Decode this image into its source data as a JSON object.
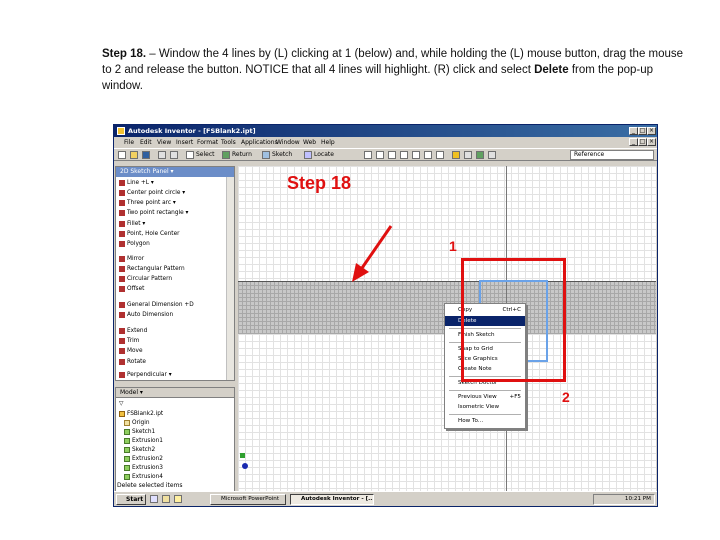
{
  "instruction": {
    "step_label": "Step 18.",
    "text_before_bold": " – Window the 4 lines by (L) clicking at 1 (below) and, while holding the (L) mouse button, drag the mouse to 2 and release the button. NOTICE that all 4 lines will highlight. (R) click and select ",
    "bold_word": "Delete",
    "text_after_bold": " from the pop-up window."
  },
  "window": {
    "title": "Autodesk Inventor - [FSBlank2.ipt]",
    "controls": [
      "_",
      "□",
      "×"
    ]
  },
  "menubar": [
    "File",
    "Edit",
    "View",
    "Insert",
    "Format",
    "Tools",
    "Applications",
    "Window",
    "Web",
    "Help"
  ],
  "toolbar2": {
    "select": "Select",
    "return": "Return",
    "sketch": "Sketch",
    "locate": "Locate",
    "reference": "Reference"
  },
  "panel": {
    "title": "2D Sketch Panel ▾",
    "items": [
      "Line  +L ▾",
      "Center point circle ▾",
      "Three point arc ▾",
      "Two point rectangle ▾",
      "Fillet ▾",
      "Point, Hole Center",
      "Polygon",
      "Mirror",
      "Rectangular Pattern",
      "Circular Pattern",
      "Offset",
      "General Dimension  +D",
      "Auto Dimension",
      "Extend",
      "Trim",
      "Move",
      "Rotate",
      "Perpendicular ▾"
    ]
  },
  "browser": {
    "title": "Model ▾",
    "tree": [
      "FSBlank2.ipt",
      "Origin",
      "Sketch1",
      "Extrusion1",
      "Sketch2",
      "Extrusion2",
      "Extrusion3",
      "Extrusion4"
    ]
  },
  "context_menu": {
    "items": [
      {
        "label": "Copy",
        "shortcut": "Ctrl+C"
      },
      {
        "label": "Delete",
        "shortcut": ""
      },
      {
        "label": "Finish Sketch",
        "shortcut": ""
      },
      {
        "label": "Snap to Grid",
        "shortcut": ""
      },
      {
        "label": "Slice Graphics",
        "shortcut": ""
      },
      {
        "label": "Create Note",
        "shortcut": ""
      },
      {
        "label": "Sketch Doctor",
        "shortcut": ""
      },
      {
        "label": "Previous View",
        "shortcut": "+F5"
      },
      {
        "label": "Isometric View",
        "shortcut": ""
      },
      {
        "label": "How To...",
        "shortcut": ""
      }
    ]
  },
  "status": "Delete selected items",
  "taskbar": {
    "start": "Start",
    "buttons": [
      "Microsoft PowerPoint",
      "Autodesk Inventor - [..."
    ],
    "clock": "10:21 PM"
  },
  "annotations": {
    "step": "Step 18",
    "point1": "1",
    "point2": "2"
  },
  "colors": {
    "annotation_red": "#e01010",
    "title_blue": "#0a246a",
    "selection_blue": "#6aa2e8"
  }
}
